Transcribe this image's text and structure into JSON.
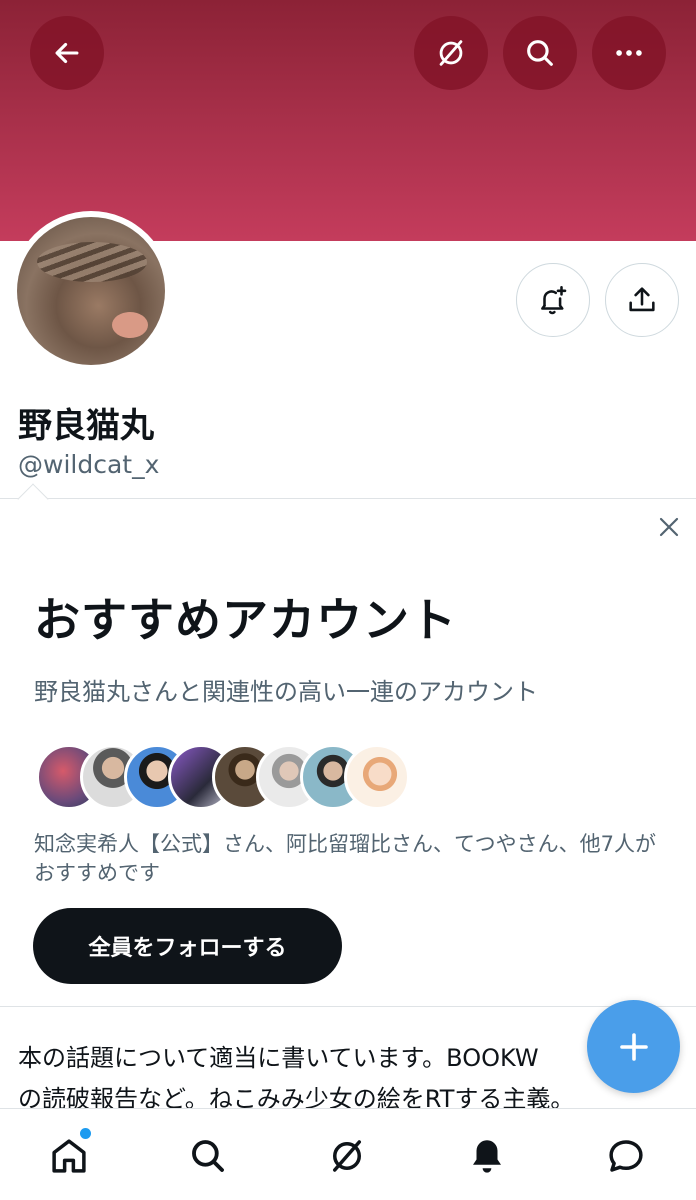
{
  "header": {
    "back_icon": "arrow-left-icon",
    "spaces_icon": "slashed-circle-icon",
    "search_icon": "search-icon",
    "more_icon": "more-horizontal-icon"
  },
  "profile": {
    "display_name": "野良猫丸",
    "handle": "@wildcat_x",
    "notify_icon": "bell-plus-icon",
    "share_icon": "share-icon"
  },
  "recommend": {
    "title": "おすすめアカウント",
    "subtitle": "野良猫丸さんと関連性の高い一連のアカウント",
    "followed_by": "知念実希人【公式】さん、阿比留瑠比さん、てつやさん、他7人がおすすめです",
    "follow_all_label": "全員をフォローする",
    "close_icon": "close-icon"
  },
  "bio": {
    "line1": "本の話題について適当に書いています。BOOKW",
    "line2": "の読破報告など。ねこみみ少女の絵をRTする主義。"
  },
  "fab_icon": "plus-icon",
  "nav": {
    "home": "home-icon",
    "search": "search-icon",
    "spaces": "slashed-circle-icon",
    "notifications": "bell-icon",
    "messages": "message-icon"
  },
  "colors": {
    "banner_top": "#8c2236",
    "banner_bottom": "#c43c5c",
    "fab": "#4a9eea",
    "follow_all_bg": "#0f1419",
    "badge": "#1d9bf0"
  }
}
